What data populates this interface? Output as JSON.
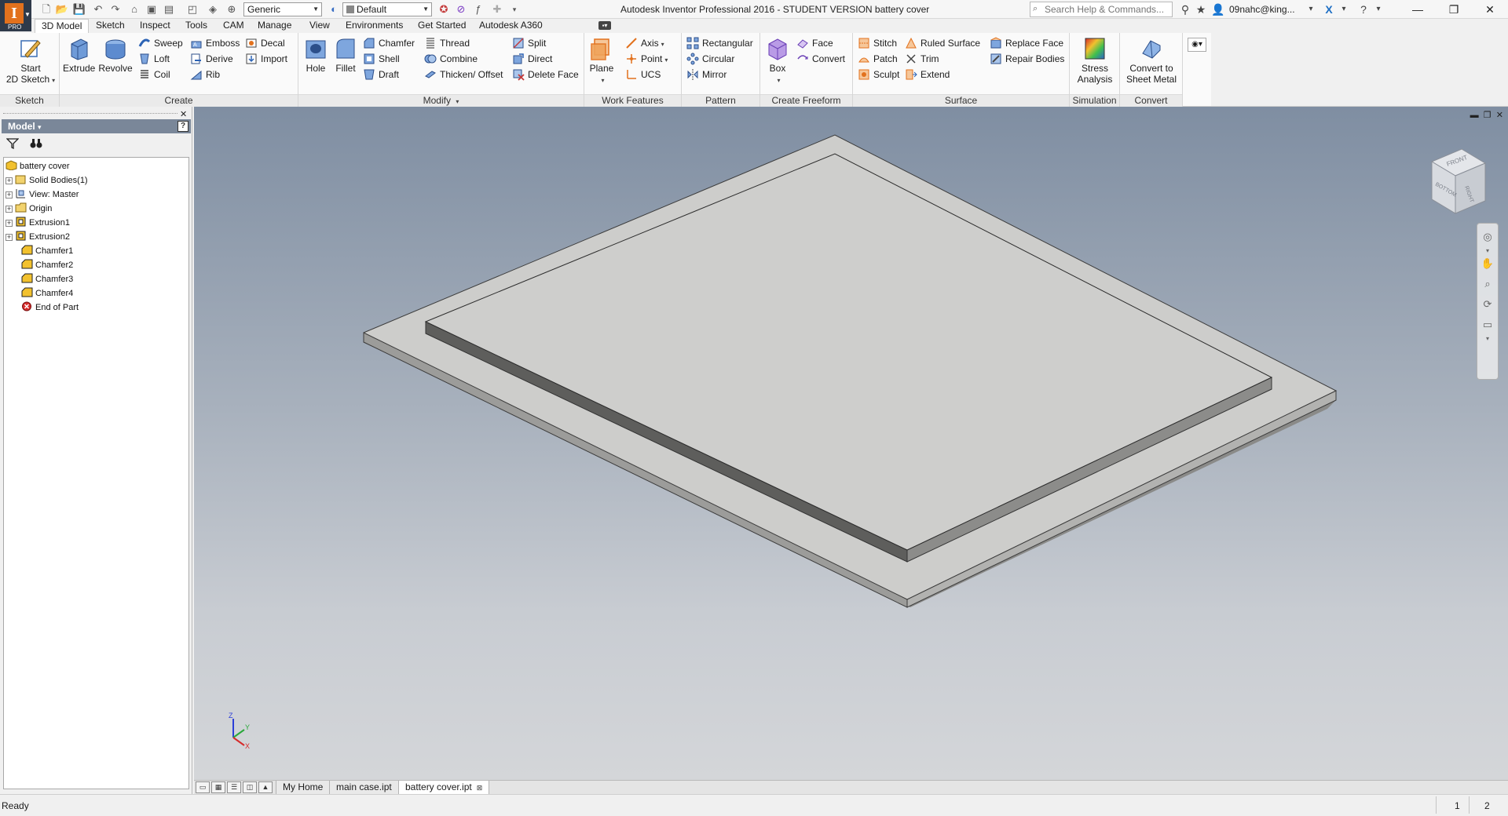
{
  "titlebar": {
    "app_badge": "PRO",
    "material_value": "Generic",
    "appearance_value": "Default",
    "title": "Autodesk Inventor Professional 2016 - STUDENT VERSION   battery cover",
    "search_placeholder": "Search Help & Commands...",
    "user": "09nahc@king..."
  },
  "tabs": [
    "3D Model",
    "Sketch",
    "Inspect",
    "Tools",
    "CAM",
    "Manage",
    "View",
    "Environments",
    "Get Started",
    "Autodesk A360"
  ],
  "ribbon": {
    "sketch": {
      "title": "Sketch",
      "start_line1": "Start",
      "start_line2": "2D Sketch"
    },
    "create": {
      "title": "Create",
      "extrude": "Extrude",
      "revolve": "Revolve",
      "sweep": "Sweep",
      "emboss": "Emboss",
      "decal": "Decal",
      "loft": "Loft",
      "derive": "Derive",
      "import": "Import",
      "coil": "Coil",
      "rib": "Rib"
    },
    "modify": {
      "title": "Modify",
      "hole": "Hole",
      "fillet": "Fillet",
      "chamfer": "Chamfer",
      "thread": "Thread",
      "split": "Split",
      "shell": "Shell",
      "combine": "Combine",
      "direct": "Direct",
      "draft": "Draft",
      "thicken": "Thicken/ Offset",
      "delete_face": "Delete Face"
    },
    "work": {
      "title": "Work Features",
      "plane": "Plane",
      "axis": "Axis",
      "point": "Point",
      "ucs": "UCS"
    },
    "pattern": {
      "title": "Pattern",
      "rectangular": "Rectangular",
      "circular": "Circular",
      "mirror": "Mirror"
    },
    "freeform": {
      "title": "Create Freeform",
      "box": "Box",
      "face": "Face",
      "convert": "Convert"
    },
    "surface": {
      "title": "Surface",
      "stitch": "Stitch",
      "ruled": "Ruled Surface",
      "replace": "Replace Face",
      "patch": "Patch",
      "trim": "Trim",
      "repair": "Repair Bodies",
      "sculpt": "Sculpt",
      "extend": "Extend"
    },
    "simulation": {
      "title": "Simulation",
      "stress_line1": "Stress",
      "stress_line2": "Analysis"
    },
    "convert": {
      "title": "Convert",
      "sheet_line1": "Convert to",
      "sheet_line2": "Sheet Metal"
    }
  },
  "browser": {
    "header": "Model",
    "help": "?",
    "tree": [
      {
        "label": "battery cover",
        "icon": "part-icon",
        "expander": ""
      },
      {
        "label": "Solid Bodies(1)",
        "icon": "solid-bodies-icon",
        "expander": "+"
      },
      {
        "label": "View: Master",
        "icon": "view-icon",
        "expander": "+"
      },
      {
        "label": "Origin",
        "icon": "origin-folder-icon",
        "expander": "+"
      },
      {
        "label": "Extrusion1",
        "icon": "extrusion-icon",
        "expander": "+"
      },
      {
        "label": "Extrusion2",
        "icon": "extrusion-icon",
        "expander": "+"
      },
      {
        "label": "Chamfer1",
        "icon": "chamfer-icon",
        "expander": ""
      },
      {
        "label": "Chamfer2",
        "icon": "chamfer-icon",
        "expander": ""
      },
      {
        "label": "Chamfer3",
        "icon": "chamfer-icon",
        "expander": ""
      },
      {
        "label": "Chamfer4",
        "icon": "chamfer-icon",
        "expander": ""
      },
      {
        "label": "End of Part",
        "icon": "end-of-part-icon",
        "expander": ""
      }
    ]
  },
  "viewcube": {
    "front": "FRONT",
    "side": "RIGHT",
    "bottom": "BOTTOM"
  },
  "triad": {
    "x": "X",
    "y": "Y",
    "z": "Z"
  },
  "doctabs": [
    "My Home",
    "main case.ipt",
    "battery cover.ipt"
  ],
  "status": {
    "text": "Ready",
    "num1": "1",
    "num2": "2"
  },
  "colors": {
    "accent": "#e2711d",
    "viewport_top": "#7f8ea2",
    "viewport_bottom": "#d4d6d9",
    "model_top": "#cdcdcb",
    "model_side": "#8a8a88"
  }
}
